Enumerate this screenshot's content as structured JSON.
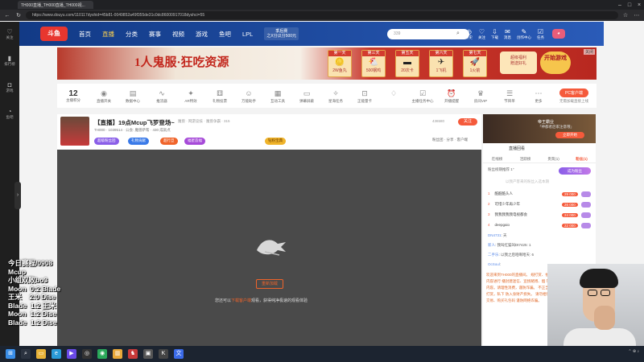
{
  "browser": {
    "tab_title": "TH000直播_TH000直播_TH000视...",
    "url": "https://www.douyu.com/110117dyshid=45b81-0049852a49f355de31c0dc86000917018dyshci=55",
    "back_icon": "back-arrow-icon",
    "refresh_icon": "refresh-icon"
  },
  "sidebar": {
    "items": [
      {
        "label": "关注",
        "icon": "heart-icon"
      },
      {
        "label": "排行榜",
        "icon": "ranking-icon"
      },
      {
        "label": "游戏",
        "icon": "gamepad-icon"
      },
      {
        "label": "鱼吧",
        "icon": "fish-bar-icon"
      }
    ],
    "handle": "›",
    "bottom_label": "回到"
  },
  "topnav": {
    "logo": "斗鱼",
    "items": [
      "首页",
      "直播",
      "分类",
      "赛事",
      "视频",
      "游戏",
      "鱼吧",
      "LPL"
    ],
    "active_index": 1,
    "event_line1": "季后赛",
    "event_line2": "之X分瓜分500元",
    "search_placeholder": "339",
    "icons": [
      {
        "label": "历史",
        "glyph": "◷"
      },
      {
        "label": "关注",
        "glyph": "♡"
      },
      {
        "label": "下载",
        "glyph": "⇩"
      },
      {
        "label": "消息",
        "glyph": "✉"
      },
      {
        "label": "创作中心",
        "glyph": "✎"
      },
      {
        "label": "任务",
        "glyph": "☑"
      }
    ]
  },
  "banner": {
    "title": "1人鬼服·狂吃资源",
    "days": [
      {
        "head": "第一天",
        "prize": "2W鱼丸"
      },
      {
        "head": "第三天",
        "prize": "500钢鸡"
      },
      {
        "head": "第五天",
        "prize": "20次卡"
      },
      {
        "head": "第六天",
        "prize": "1飞机"
      },
      {
        "head": "第七天",
        "prize": "1火箭"
      }
    ],
    "cta_line1": "超级福利",
    "cta_line2": "赠送好礼",
    "play": "开始游戏",
    "close": "关闭"
  },
  "toolbar": {
    "level_value": "12",
    "level_label": "主播积分",
    "tools": [
      {
        "label": "直播开关",
        "glyph": "◉"
      },
      {
        "label": "数据中心",
        "glyph": "▤"
      },
      {
        "label": "推流器",
        "glyph": "∿"
      },
      {
        "label": "AR特效",
        "glyph": "✦"
      },
      {
        "label": "礼物投票",
        "glyph": "⚅"
      },
      {
        "label": "万能助手",
        "glyph": "☺"
      },
      {
        "label": "互动工具",
        "glyph": "▦"
      },
      {
        "label": "弹幕屏蔽",
        "glyph": "▭"
      },
      {
        "label": "星海任务",
        "glyph": "✧"
      },
      {
        "label": "正能量卡",
        "glyph": "⊡"
      },
      {
        "label": "",
        "glyph": "♢"
      },
      {
        "label": "主播任务中心",
        "glyph": "☑"
      },
      {
        "label": "开播提醒",
        "glyph": "⏰"
      },
      {
        "label": "房间VIP",
        "glyph": "♛"
      },
      {
        "label": "节目单",
        "glyph": "☰"
      },
      {
        "label": "更多",
        "glyph": "⋯"
      }
    ],
    "pc_client": "PC客户端",
    "pc_sub": "无需加载直接上线"
  },
  "room": {
    "title": "【直播】19点Mcup飞罗登场~",
    "category": "魔兽 · 网游竞技 · 魔兽争霸 · 315",
    "meta": "TH000 · 1039514 · 公会: 魔兽萨帮 · 430 成就点",
    "chips": [
      {
        "label": "超级粉丝团",
        "color": "#8a5ee8"
      },
      {
        "label": "礼物贡献",
        "color": "#3a7ae8"
      },
      {
        "label": "超行旦",
        "color": "#f0642a"
      },
      {
        "label": "福星造福",
        "color": "#a64ad8"
      },
      {
        "label": "钻粉宝典",
        "color": "#f0b42a"
      }
    ],
    "fans": "436580",
    "follow": "关注",
    "report": "粉丝团 · 分享 · 客户端"
  },
  "player": {
    "reload": "重新加载",
    "tip_prefix": "您还可以",
    "tip_link": "下载客户端",
    "tip_suffix": "观看，获得纯净极速的观看体验"
  },
  "rightpanel": {
    "anchor_title": "帝王霸业",
    "anchor_sub": "「神都者后家注意哦」",
    "anchor_btn": "立即开始",
    "rank_head": "直播回看",
    "tabs": [
      "在线榜",
      "活跃榜",
      "贵宾(1)",
      "粉丝(1)"
    ],
    "tab_active": 3,
    "rank_row": "粉丝榜期推荐 1⁺",
    "rank_join": "成为粉丝",
    "rank_hint": "以我产客来的粉丝入选本期",
    "fans": [
      {
        "n": "1",
        "name": "酷酷酷头人",
        "lv": "29",
        "val": "000"
      },
      {
        "n": "2",
        "name": "可惜少年再少年",
        "lv": "26",
        "val": "000"
      },
      {
        "n": "3",
        "name": "我我我我我电视都会",
        "lv": "24",
        "val": "000"
      },
      {
        "n": "4",
        "name": "deepgaio",
        "lv": "22",
        "val": "000"
      }
    ],
    "chats": [
      {
        "user": "DN4731",
        "text": "天"
      },
      {
        "user": "新人",
        "text": "我叫红猫叫Dt7425: 1"
      },
      {
        "user": "二手乐",
        "text": "以我之后咱啊哈天: 6"
      },
      {
        "user": "OcSoul",
        "text": ""
      }
    ],
    "notice": "欢迎来到TH000的直播间。 规打赏、依法对直播内容进行 播封建迷信、宣扬赌博、烟 等相关违规内容。请理性消费，谨防诈骗。 不正当方式诱导打赏，私下 防入身财产损失。 请勿相信 给、私下交易、购买礼包码 谨防网络诈骗。"
  },
  "overlay": {
    "lines": [
      "今日赛程/0908",
      "Mcup",
      "小组双败bo3",
      "Moon  0:2 Blade",
      "王米    2:0 Dise",
      "Blade  1:2 王米",
      "Moon  1:2 Dise",
      "Blade  1:2 Dise"
    ]
  },
  "taskbar": {
    "apps": [
      {
        "icon": "windows-start-icon",
        "color": "#3a8ee8",
        "glyph": "⊞"
      },
      {
        "icon": "search-icon",
        "color": "#2b3340",
        "glyph": "⌕"
      },
      {
        "icon": "file-explorer-icon",
        "color": "#e8b43a",
        "glyph": "▭"
      },
      {
        "icon": "edge-icon",
        "color": "#2a9ad8",
        "glyph": "e"
      },
      {
        "icon": "media-icon",
        "color": "#6a4ae8",
        "glyph": "▶"
      },
      {
        "icon": "obs-icon",
        "color": "#333",
        "glyph": "◎"
      },
      {
        "icon": "green-app-icon",
        "color": "#2aa85a",
        "glyph": "◉"
      },
      {
        "icon": "folder-icon",
        "color": "#e8a83a",
        "glyph": "▥"
      },
      {
        "icon": "game-icon",
        "color": "#c83a3a",
        "glyph": "♞"
      },
      {
        "icon": "app-icon",
        "color": "#555",
        "glyph": "▣"
      },
      {
        "icon": "kaf-icon",
        "color": "#444",
        "glyph": "K"
      },
      {
        "icon": "translate-icon",
        "color": "#3a6ae8",
        "glyph": "文"
      }
    ]
  }
}
